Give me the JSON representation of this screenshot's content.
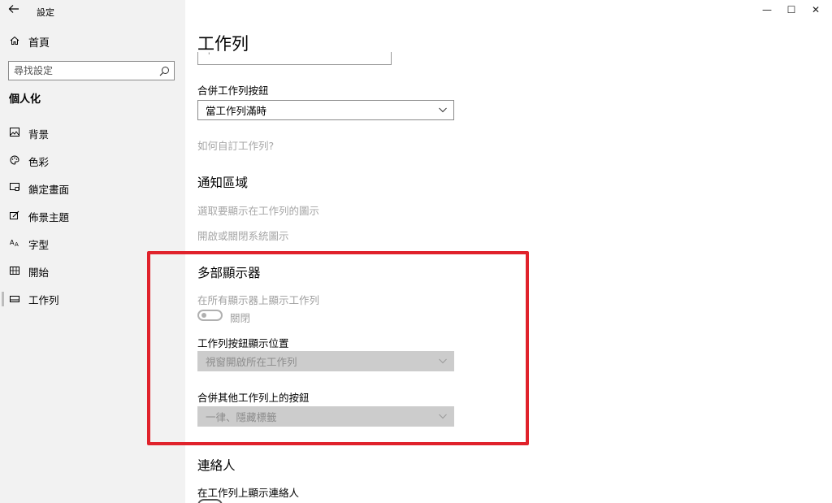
{
  "window": {
    "app_title": "設定",
    "controls": {
      "minimize": "—",
      "maximize": "☐",
      "close": "✕"
    }
  },
  "sidebar": {
    "home_label": "首頁",
    "search_placeholder": "尋找設定",
    "section_label": "個人化",
    "items": [
      {
        "label": "背景",
        "icon": "image-icon"
      },
      {
        "label": "色彩",
        "icon": "palette-icon"
      },
      {
        "label": "鎖定畫面",
        "icon": "lock-screen-icon"
      },
      {
        "label": "佈景主題",
        "icon": "theme-brush-icon"
      },
      {
        "label": "字型",
        "icon": "font-icon"
      },
      {
        "label": "開始",
        "icon": "start-tiles-icon"
      },
      {
        "label": "工作列",
        "icon": "taskbar-icon",
        "active": true
      }
    ]
  },
  "main": {
    "title": "工作列",
    "partial_field_text": "'",
    "combine_buttons": {
      "label": "合併工作列按鈕",
      "value": "當工作列滿時"
    },
    "customize_link": "如何自訂工作列?",
    "notification_area": {
      "heading": "通知區域",
      "link1": "選取要顯示在工作列的圖示",
      "link2": "開啟或關閉系統圖示"
    },
    "multi_display": {
      "heading": "多部顯示器",
      "show_all_label": "在所有顯示器上顯示工作列",
      "show_all_state": "關閉",
      "show_all_on": false,
      "buttons_position_label": "工作列按鈕顯示位置",
      "buttons_position_value": "視窗開啟所在工作列",
      "combine_other_label": "合併其他工作列上的按鈕",
      "combine_other_value": "一律、隱藏標籤"
    },
    "people": {
      "heading": "連絡人",
      "show_contacts_label": "在工作列上顯示連絡人"
    }
  },
  "colors": {
    "highlight_border": "#e0222b",
    "sidebar_bg": "#f2f2f2",
    "disabled_dropdown": "#cccccc"
  }
}
